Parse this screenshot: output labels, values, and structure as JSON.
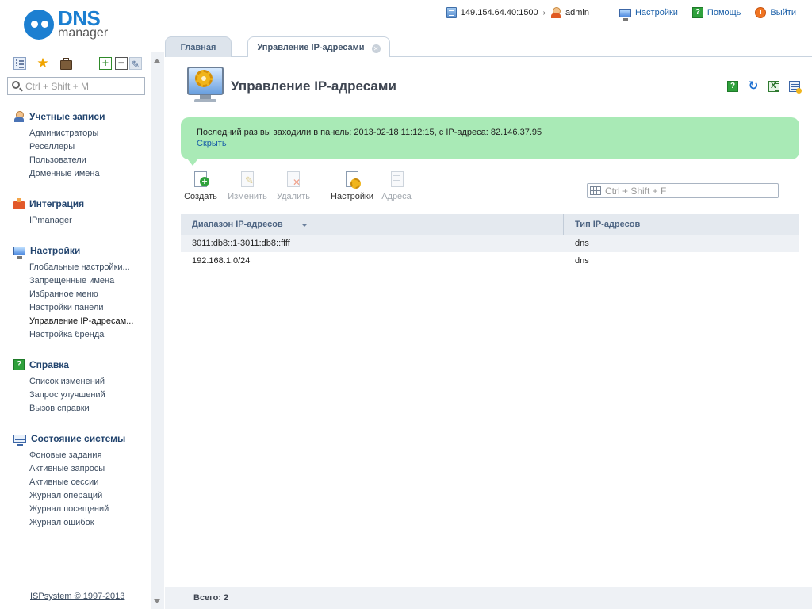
{
  "app": {
    "logo_main": "DNS",
    "logo_sub": "manager"
  },
  "topbar": {
    "server": "149.154.64.40:1500",
    "separator": "›",
    "user": "admin",
    "settings": "Настройки",
    "help": "Помощь",
    "logout": "Выйти"
  },
  "sidebar": {
    "search_placeholder": "Ctrl + Shift + M",
    "groups": [
      {
        "title": "Учетные записи",
        "icon": "accounts-icon",
        "items": [
          "Администраторы",
          "Реселлеры",
          "Пользователи",
          "Доменные имена"
        ]
      },
      {
        "title": "Интеграция",
        "icon": "integration-icon",
        "items": [
          "IPmanager"
        ]
      },
      {
        "title": "Настройки",
        "icon": "settings-monitor-icon",
        "items": [
          "Глобальные настройки...",
          "Запрещенные имена",
          "Избранное меню",
          "Настройки панели",
          "Управление IP-адресам...",
          "Настройка бренда"
        ]
      },
      {
        "title": "Справка",
        "icon": "help-icon",
        "items": [
          "Список изменений",
          "Запрос улучшений",
          "Вызов справки"
        ]
      },
      {
        "title": "Состояние системы",
        "icon": "system-status-icon",
        "items": [
          "Фоновые задания",
          "Активные запросы",
          "Активные сессии",
          "Журнал операций",
          "Журнал посещений",
          "Журнал ошибок"
        ]
      }
    ],
    "copyright": "ISPsystem © 1997-2013"
  },
  "tabs": [
    {
      "label": "Главная",
      "active": false
    },
    {
      "label": "Управление IP-адресами",
      "active": true
    }
  ],
  "page": {
    "title": "Управление IP-адресами",
    "notice": "Последний раз вы заходили в панель: 2013-02-18 11:12:15, с IP-адреса: 82.146.37.95",
    "notice_link": "Скрыть",
    "filter_placeholder": "Ctrl + Shift + F"
  },
  "toolbar": {
    "create": "Создать",
    "edit": "Изменить",
    "delete": "Удалить",
    "settings": "Настройки",
    "addresses": "Адреса"
  },
  "table": {
    "columns": [
      "Диапазон IP-адресов",
      "Тип IP-адресов"
    ],
    "rows": [
      [
        "3011:db8::1-3011:db8::ffff",
        "dns"
      ],
      [
        "192.168.1.0/24",
        "dns"
      ]
    ]
  },
  "footer": {
    "total": "Всего: 2"
  },
  "colors": {
    "brand": "#1c7fd1",
    "notice_bg": "#a9eab6",
    "header_bg": "#e4e9ef"
  }
}
